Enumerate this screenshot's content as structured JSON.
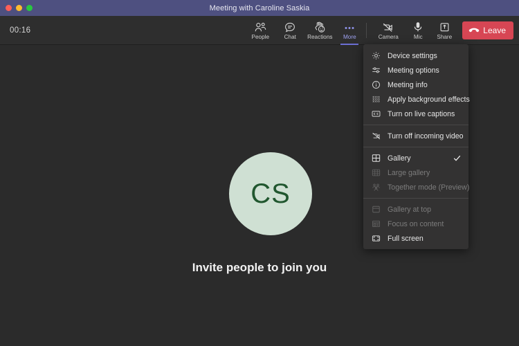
{
  "window": {
    "title": "Meeting with Caroline Saskia",
    "titlebar_color": "#4e5080",
    "controls": [
      {
        "name": "close",
        "color": "#ff5f57"
      },
      {
        "name": "minimize",
        "color": "#febc2e"
      },
      {
        "name": "maximize",
        "color": "#28c840"
      }
    ]
  },
  "toolbar": {
    "timer": "00:16",
    "tools": [
      {
        "label": "People",
        "icon": "people-icon",
        "active": false
      },
      {
        "label": "Chat",
        "icon": "chat-icon",
        "active": false
      },
      {
        "label": "Reactions",
        "icon": "reactions-icon",
        "active": false
      },
      {
        "label": "More",
        "icon": "more-ellipsis-icon",
        "active": true
      },
      {
        "label": "Camera",
        "icon": "camera-off-icon",
        "active": false
      },
      {
        "label": "Mic",
        "icon": "mic-icon",
        "active": false
      },
      {
        "label": "Share",
        "icon": "share-icon",
        "active": false
      }
    ],
    "leave_label": "Leave",
    "leave_icon": "hangup-icon",
    "leave_color": "#d74654",
    "active_accent": "#9ea2f0"
  },
  "stage": {
    "avatar_initials": "CS",
    "avatar_bg": "#cfe0d3",
    "avatar_fg": "#21572f",
    "invite_text": "Invite people to join you"
  },
  "menu": {
    "groups": [
      {
        "items": [
          {
            "label": "Device settings",
            "icon": "gear-icon",
            "disabled": false,
            "checked": false
          },
          {
            "label": "Meeting options",
            "icon": "sliders-icon",
            "disabled": false,
            "checked": false
          },
          {
            "label": "Meeting info",
            "icon": "info-icon",
            "disabled": false,
            "checked": false
          },
          {
            "label": "Apply background effects",
            "icon": "background-effects-icon",
            "disabled": false,
            "checked": false
          },
          {
            "label": "Turn on live captions",
            "icon": "closed-captions-icon",
            "disabled": false,
            "checked": false
          }
        ]
      },
      {
        "items": [
          {
            "label": "Turn off incoming video",
            "icon": "video-off-icon",
            "disabled": false,
            "checked": false
          }
        ]
      },
      {
        "items": [
          {
            "label": "Gallery",
            "icon": "gallery-icon",
            "disabled": false,
            "checked": true
          },
          {
            "label": "Large gallery",
            "icon": "large-gallery-icon",
            "disabled": true,
            "checked": false
          },
          {
            "label": "Together mode (Preview)",
            "icon": "together-mode-icon",
            "disabled": true,
            "checked": false
          }
        ]
      },
      {
        "items": [
          {
            "label": "Gallery at top",
            "icon": "gallery-at-top-icon",
            "disabled": true,
            "checked": false
          },
          {
            "label": "Focus on content",
            "icon": "focus-on-content-icon",
            "disabled": true,
            "checked": false
          },
          {
            "label": "Full screen",
            "icon": "full-screen-icon",
            "disabled": false,
            "checked": false
          }
        ]
      }
    ]
  }
}
